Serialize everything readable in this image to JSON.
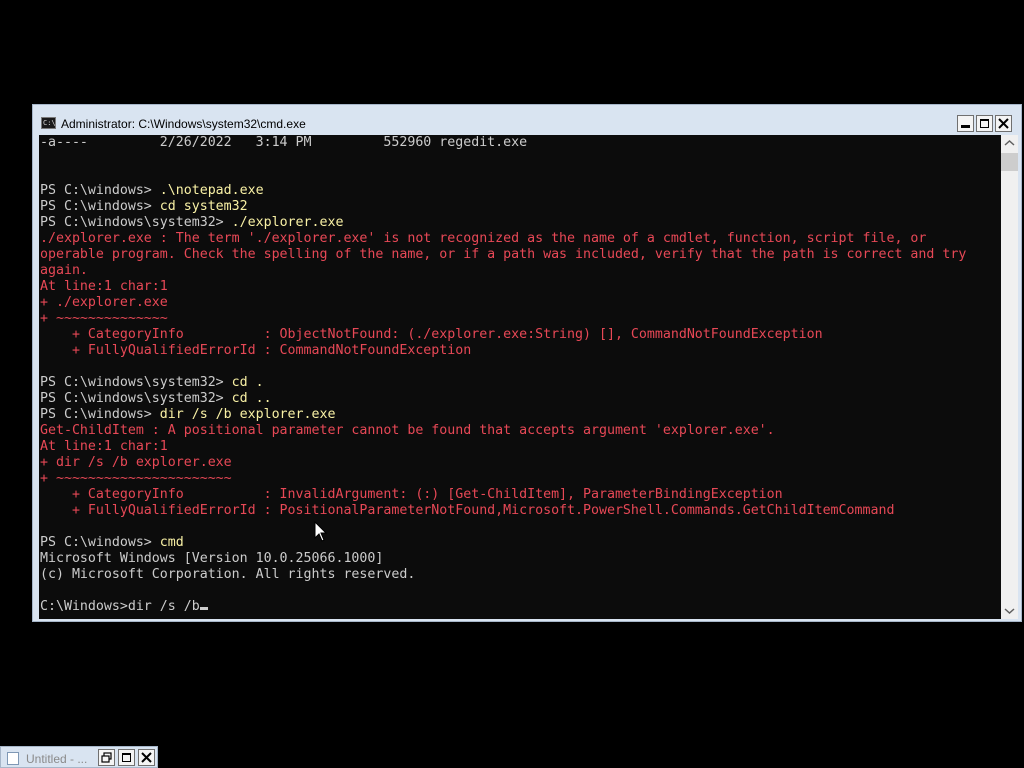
{
  "window": {
    "title": "Administrator: C:\\Windows\\system32\\cmd.exe",
    "app_icon_text": "C:\\"
  },
  "console": {
    "lines": [
      {
        "text": "-a----         2/26/2022   3:14 PM         552960 regedit.exe",
        "color": "gray"
      },
      {
        "text": "",
        "color": "gray"
      },
      {
        "text": "",
        "color": "gray"
      },
      {
        "text": "PS C:\\windows> ",
        "cmd": ".\\notepad.exe",
        "color": "gray"
      },
      {
        "text": "PS C:\\windows> ",
        "cmd": "cd system32",
        "color": "gray"
      },
      {
        "text": "PS C:\\windows\\system32> ",
        "cmd": "./explorer.exe",
        "color": "gray"
      },
      {
        "text": "./explorer.exe : The term './explorer.exe' is not recognized as the name of a cmdlet, function, script file, or",
        "color": "red"
      },
      {
        "text": "operable program. Check the spelling of the name, or if a path was included, verify that the path is correct and try",
        "color": "red"
      },
      {
        "text": "again.",
        "color": "red"
      },
      {
        "text": "At line:1 char:1",
        "color": "red"
      },
      {
        "text": "+ ./explorer.exe",
        "color": "red"
      },
      {
        "text": "+ ~~~~~~~~~~~~~~",
        "color": "red"
      },
      {
        "text": "    + CategoryInfo          : ObjectNotFound: (./explorer.exe:String) [], CommandNotFoundException",
        "color": "red"
      },
      {
        "text": "    + FullyQualifiedErrorId : CommandNotFoundException",
        "color": "red"
      },
      {
        "text": "",
        "color": "gray"
      },
      {
        "text": "PS C:\\windows\\system32> ",
        "cmd": "cd .",
        "color": "gray"
      },
      {
        "text": "PS C:\\windows\\system32> ",
        "cmd": "cd ..",
        "color": "gray"
      },
      {
        "text": "PS C:\\windows> ",
        "cmd": "dir /s /b explorer.exe",
        "color": "gray"
      },
      {
        "text": "Get-ChildItem : A positional parameter cannot be found that accepts argument 'explorer.exe'.",
        "color": "red"
      },
      {
        "text": "At line:1 char:1",
        "color": "red"
      },
      {
        "text": "+ dir /s /b explorer.exe",
        "color": "red"
      },
      {
        "text": "+ ~~~~~~~~~~~~~~~~~~~~~~",
        "color": "red"
      },
      {
        "text": "    + CategoryInfo          : InvalidArgument: (:) [Get-ChildItem], ParameterBindingException",
        "color": "red"
      },
      {
        "text": "    + FullyQualifiedErrorId : PositionalParameterNotFound,Microsoft.PowerShell.Commands.GetChildItemCommand",
        "color": "red"
      },
      {
        "text": "",
        "color": "gray"
      },
      {
        "text": "PS C:\\windows> ",
        "cmd": "cmd",
        "color": "gray"
      },
      {
        "text": "Microsoft Windows [Version 10.0.25066.1000]",
        "color": "gray"
      },
      {
        "text": "(c) Microsoft Corporation. All rights reserved.",
        "color": "gray"
      },
      {
        "text": "",
        "color": "gray"
      },
      {
        "text": "C:\\Windows>dir /s /b",
        "color": "gray",
        "cursor": true
      }
    ]
  },
  "taskbar": {
    "item_label": "Untitled - ..."
  },
  "colors": {
    "console_bg": "#0c0c0c",
    "text_gray": "#cccccc",
    "text_yellow": "#f9f1a5",
    "text_red": "#e74856",
    "chrome": "#d9e4f1"
  }
}
